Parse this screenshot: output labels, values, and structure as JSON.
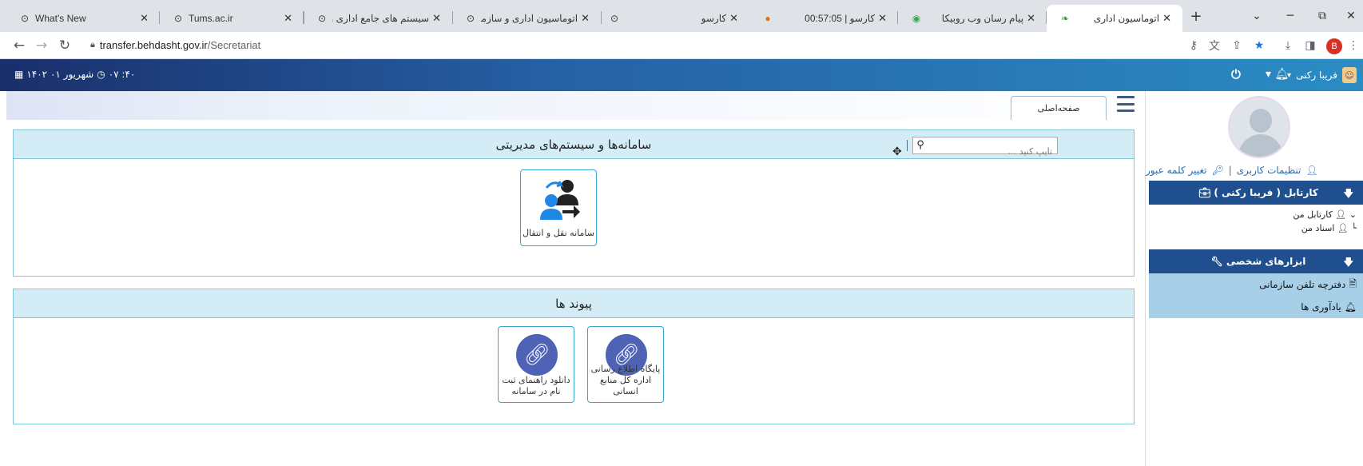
{
  "browser": {
    "tabs": [
      {
        "title": "What's New",
        "fav": "⊙",
        "active": false
      },
      {
        "title": "Tums.ac.ir",
        "fav": "⊙",
        "active": false
      },
      {
        "title": "سیستم های جامع اداری و ما",
        "fav": "⊙",
        "active": false
      },
      {
        "title": "اتوماسیون اداری و سازمان ا",
        "fav": "⊙",
        "active": false
      },
      {
        "title": "کارسو",
        "fav": "⊙",
        "active": false
      },
      {
        "title": "کارسو | 00:57:05",
        "fav": "●",
        "active": false
      },
      {
        "title": "پیام رسان وب روبیکا",
        "fav": "◉",
        "active": false
      },
      {
        "title": "اتوماسیون اداری",
        "fav": "❧",
        "active": true
      }
    ],
    "new_tab": "+",
    "window": {
      "dropdown": "⌄",
      "minimize": "─",
      "restore": "⧉",
      "close": "✕"
    },
    "url_host": "transfer.behdasht.gov.ir",
    "url_path": "/Secretariat",
    "profile_letter": "B"
  },
  "header": {
    "date": "۱۴۰۲ ۰۱ شهریور",
    "time": "۰۷ :۴۰",
    "user_name": "فریبا رکنی"
  },
  "sidebar": {
    "settings_link": "تنظیمات کاربری",
    "password_link": "تغییر کلمه عبور",
    "cartable_title": "کارتابل ( فریبا رکنی )",
    "tree": [
      "کارتابل من",
      "اسناد من"
    ],
    "tools_title": "ابزارهای شخصی",
    "tools": [
      "دفترچه تلفن سازمانی",
      "یادآوری ها"
    ]
  },
  "main": {
    "home_tab": "صفحه‌اصلی",
    "systems_title": "سامانه‌ها و سیستم‌های مدیریتی",
    "search_placeholder": "تایپ کنید ...",
    "system_tiles": [
      {
        "label": "سامانه نقل و انتقال"
      }
    ],
    "links_title": "پیوند ها",
    "link_tiles": [
      {
        "label": "پایگاه اطلاع رسانی اداره کل منابع انسانی"
      },
      {
        "label": "دانلود راهنمای ثبت نام در سامانه"
      }
    ]
  },
  "colors": {
    "appbar_start": "#1a2f6b",
    "appbar_end": "#2b8cc4",
    "sidebar_head": "#1f4f8f",
    "tool_row": "#a8cfe8",
    "panel_border": "#7fc6d6",
    "panel_head": "#d4ecf6",
    "link_circle": "#4e63b5"
  }
}
